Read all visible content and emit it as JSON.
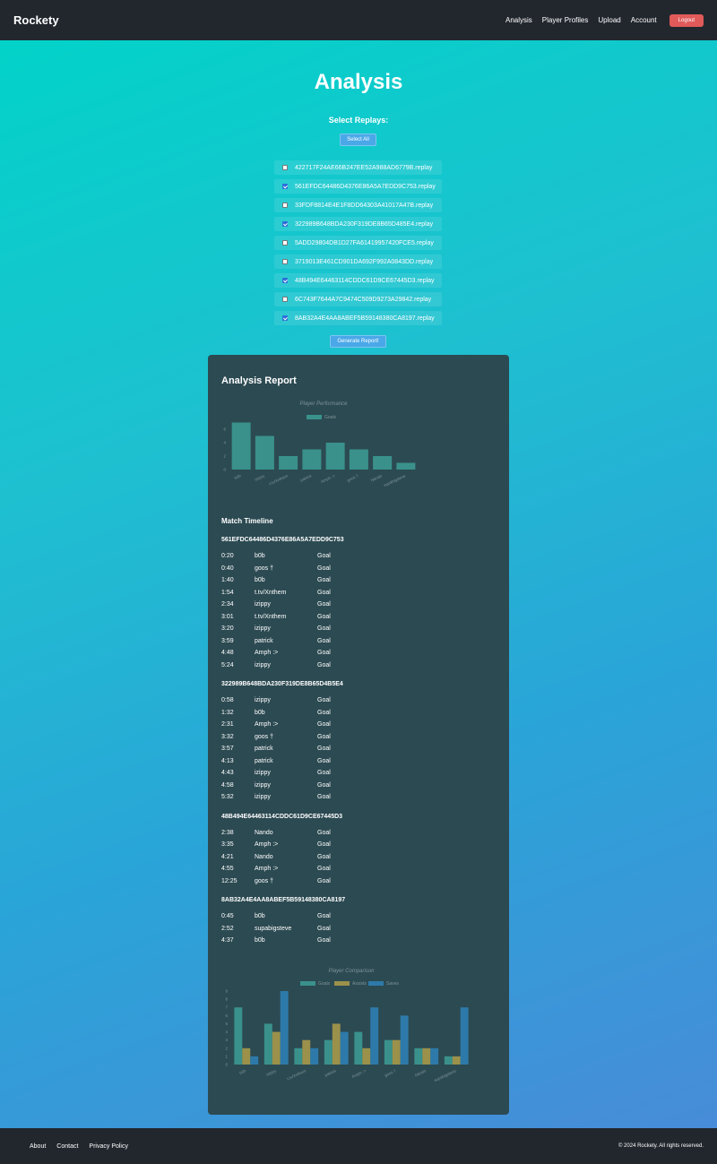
{
  "navbar": {
    "brand": "Rockety",
    "links": [
      "Analysis",
      "Player Profiles",
      "Upload",
      "Account"
    ],
    "logout_label": "Logout"
  },
  "page": {
    "title": "Analysis",
    "select_label": "Select Replays:",
    "select_all_label": "Select All",
    "generate_label": "Generate Report!"
  },
  "replays": [
    {
      "name": "422717F24AE66B247EE52A988AD6779B.replay",
      "checked": false
    },
    {
      "name": "561EFDC64486D4376E86A5A7EDD9C753.replay",
      "checked": true
    },
    {
      "name": "33FDF8814E4E1F8DD64303A41017A47B.replay",
      "checked": false
    },
    {
      "name": "322989B648BDA230F319DE8B65D485E4.replay",
      "checked": true
    },
    {
      "name": "5ADD29804DB1D27FA61419957420FCE5.replay",
      "checked": false
    },
    {
      "name": "3719013E461CD901DA692F992A0843DD.replay",
      "checked": false
    },
    {
      "name": "48B494E64463114CDDC61D9CE67445D3.replay",
      "checked": true
    },
    {
      "name": "6C743F7644A7C9474C509D9273A29842.replay",
      "checked": false
    },
    {
      "name": "8AB32A4E4AA8ABEF5B59148380CA8197.replay",
      "checked": true
    }
  ],
  "report": {
    "title": "Analysis Report",
    "timeline_title": "Match Timeline",
    "matches": [
      {
        "id": "561EFDC64486D4376E86A5A7EDD9C753",
        "events": [
          {
            "time": "0:20",
            "player": "b0b",
            "type": "Goal"
          },
          {
            "time": "0:40",
            "player": "goos †",
            "type": "Goal"
          },
          {
            "time": "1:40",
            "player": "b0b",
            "type": "Goal"
          },
          {
            "time": "1:54",
            "player": "t.tv/Xnthem",
            "type": "Goal"
          },
          {
            "time": "2:34",
            "player": "izippy",
            "type": "Goal"
          },
          {
            "time": "3:01",
            "player": "t.tv/Xnthem",
            "type": "Goal"
          },
          {
            "time": "3:20",
            "player": "izippy",
            "type": "Goal"
          },
          {
            "time": "3:59",
            "player": "patrick",
            "type": "Goal"
          },
          {
            "time": "4:48",
            "player": "Amph :>",
            "type": "Goal"
          },
          {
            "time": "5:24",
            "player": "izippy",
            "type": "Goal"
          }
        ]
      },
      {
        "id": "322989B648BDA230F319DE8B65D4B5E4",
        "events": [
          {
            "time": "0:58",
            "player": "izippy",
            "type": "Goal"
          },
          {
            "time": "1:32",
            "player": "b0b",
            "type": "Goal"
          },
          {
            "time": "2:31",
            "player": "Amph :>",
            "type": "Goal"
          },
          {
            "time": "3:32",
            "player": "goos †",
            "type": "Goal"
          },
          {
            "time": "3:57",
            "player": "patrick",
            "type": "Goal"
          },
          {
            "time": "4:13",
            "player": "patrick",
            "type": "Goal"
          },
          {
            "time": "4:43",
            "player": "izippy",
            "type": "Goal"
          },
          {
            "time": "4:58",
            "player": "izippy",
            "type": "Goal"
          },
          {
            "time": "5:32",
            "player": "izippy",
            "type": "Goal"
          }
        ]
      },
      {
        "id": "48B494E64463114CDDC61D9CE67445D3",
        "events": [
          {
            "time": "2:38",
            "player": "Nando",
            "type": "Goal"
          },
          {
            "time": "3:35",
            "player": "Amph :>",
            "type": "Goal"
          },
          {
            "time": "4:21",
            "player": "Nando",
            "type": "Goal"
          },
          {
            "time": "4:55",
            "player": "Amph :>",
            "type": "Goal"
          },
          {
            "time": "12:25",
            "player": "goos †",
            "type": "Goal"
          }
        ]
      },
      {
        "id": "8AB32A4E4AA8ABEF5B59148380CA8197",
        "events": [
          {
            "time": "0:45",
            "player": "b0b",
            "type": "Goal"
          },
          {
            "time": "2:52",
            "player": "supabigsteve",
            "type": "Goal"
          },
          {
            "time": "4:37",
            "player": "b0b",
            "type": "Goal"
          }
        ]
      }
    ]
  },
  "footer": {
    "links": [
      "About",
      "Contact",
      "Privacy Policy"
    ],
    "copyright": "© 2024 Rockety. All rights reserved."
  },
  "colors": {
    "goals": "#3fa39a",
    "assists": "#b8a24a",
    "saves": "#2e86c1",
    "navbar": "#22272e",
    "logout": "#e05a5a"
  },
  "chart_data": [
    {
      "type": "bar",
      "title": "Player Performance",
      "categories": [
        "b0b",
        "izippy",
        "t.tv/Xnthem",
        "patrick",
        "Amph :>",
        "goos †",
        "Nando",
        "supabigsteve"
      ],
      "series": [
        {
          "name": "Goals",
          "values": [
            7,
            5,
            2,
            3,
            4,
            3,
            2,
            1
          ]
        }
      ],
      "ylim": [
        0,
        8
      ],
      "yticks": [
        0,
        2,
        4,
        6
      ],
      "legend": "top"
    },
    {
      "type": "bar",
      "title": "Player Comparison",
      "categories": [
        "b0b",
        "izippy",
        "t.tv/Xnthem",
        "patrick",
        "Amph :>",
        "goos †",
        "Nando",
        "supabigsteve"
      ],
      "series": [
        {
          "name": "Goals",
          "values": [
            7,
            5,
            2,
            3,
            4,
            3,
            2,
            1
          ]
        },
        {
          "name": "Assists",
          "values": [
            2,
            4,
            3,
            5,
            2,
            3,
            2,
            1
          ]
        },
        {
          "name": "Saves",
          "values": [
            1,
            9,
            2,
            4,
            7,
            6,
            2,
            7
          ]
        }
      ],
      "ylim": [
        0,
        9
      ],
      "yticks": [
        0,
        1,
        2,
        3,
        4,
        5,
        6,
        7,
        8,
        9
      ],
      "legend": "top"
    }
  ]
}
